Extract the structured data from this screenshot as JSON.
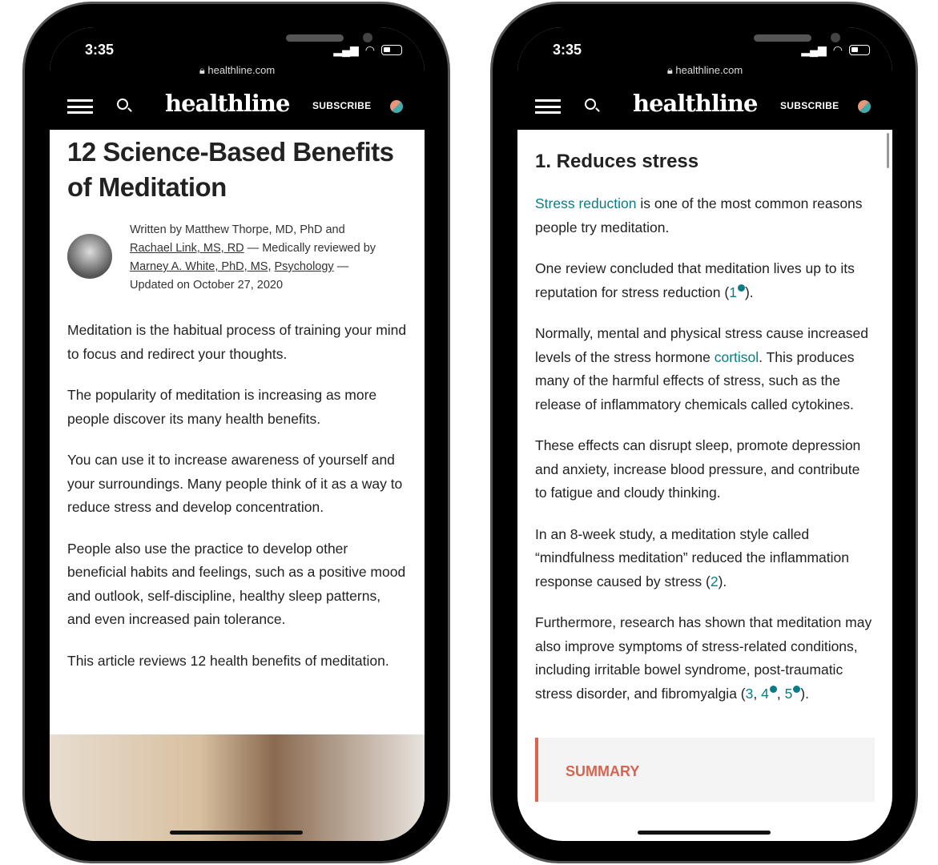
{
  "status": {
    "time": "3:35",
    "url": "healthline.com"
  },
  "nav": {
    "logo": "healthline",
    "subscribe": "SUBSCRIBE"
  },
  "left": {
    "title": "12 Science-Based Benefits of Meditation",
    "byline": {
      "written": "Written by Matthew Thorpe, MD, PhD and",
      "author2": "Rachael Link, MS, RD",
      "reviewed": " — Medically reviewed by",
      "reviewer": "Marney A. White, PhD, MS",
      "sep": ", ",
      "field": "Psychology",
      "dash": " —",
      "updated": "Updated on October 27, 2020"
    },
    "paragraphs": [
      "Meditation is the habitual process of training your mind to focus and redirect your thoughts.",
      "The popularity of meditation is increasing as more people discover its many health benefits.",
      "You can use it to increase awareness of yourself and your surroundings. Many people think of it as a way to reduce stress and develop concentration.",
      "People also use the practice to develop other beneficial habits and feelings, such as a positive mood and outlook, self-discipline, healthy sleep patterns, and even increased pain tolerance.",
      "This article reviews 12 health benefits of meditation."
    ]
  },
  "right": {
    "heading": "1. Reduces stress",
    "p1": {
      "link": "Stress reduction",
      "text": " is one of the most common reasons people try meditation."
    },
    "p2": {
      "text": "One review concluded that meditation lives up to its reputation for stress reduction (",
      "ref": "1",
      "end": ")."
    },
    "p3": {
      "text": "Normally, mental and physical stress cause increased levels of the stress hormone ",
      "link": "cortisol",
      "end": ". This produces many of the harmful effects of stress, such as the release of inflammatory chemicals called cytokines."
    },
    "p4": "These effects can disrupt sleep, promote depression and anxiety, increase blood pressure, and contribute to fatigue and cloudy thinking.",
    "p5": {
      "text": "In an 8-week study, a meditation style called “mindfulness meditation” reduced the inflammation response caused by stress (",
      "ref": "2",
      "end": ")."
    },
    "p6": {
      "text": "Furthermore, research has shown that meditation may also improve symptoms of stress-related conditions, including irritable bowel syndrome, post-traumatic stress disorder, and fibromyalgia (",
      "ref1": "3",
      "c1": ", ",
      "ref2": "4",
      "c2": ", ",
      "ref3": "5",
      "end": ")."
    },
    "summary": "SUMMARY"
  },
  "colors": {
    "link": "#0a7c86",
    "summary": "#d9634f"
  }
}
